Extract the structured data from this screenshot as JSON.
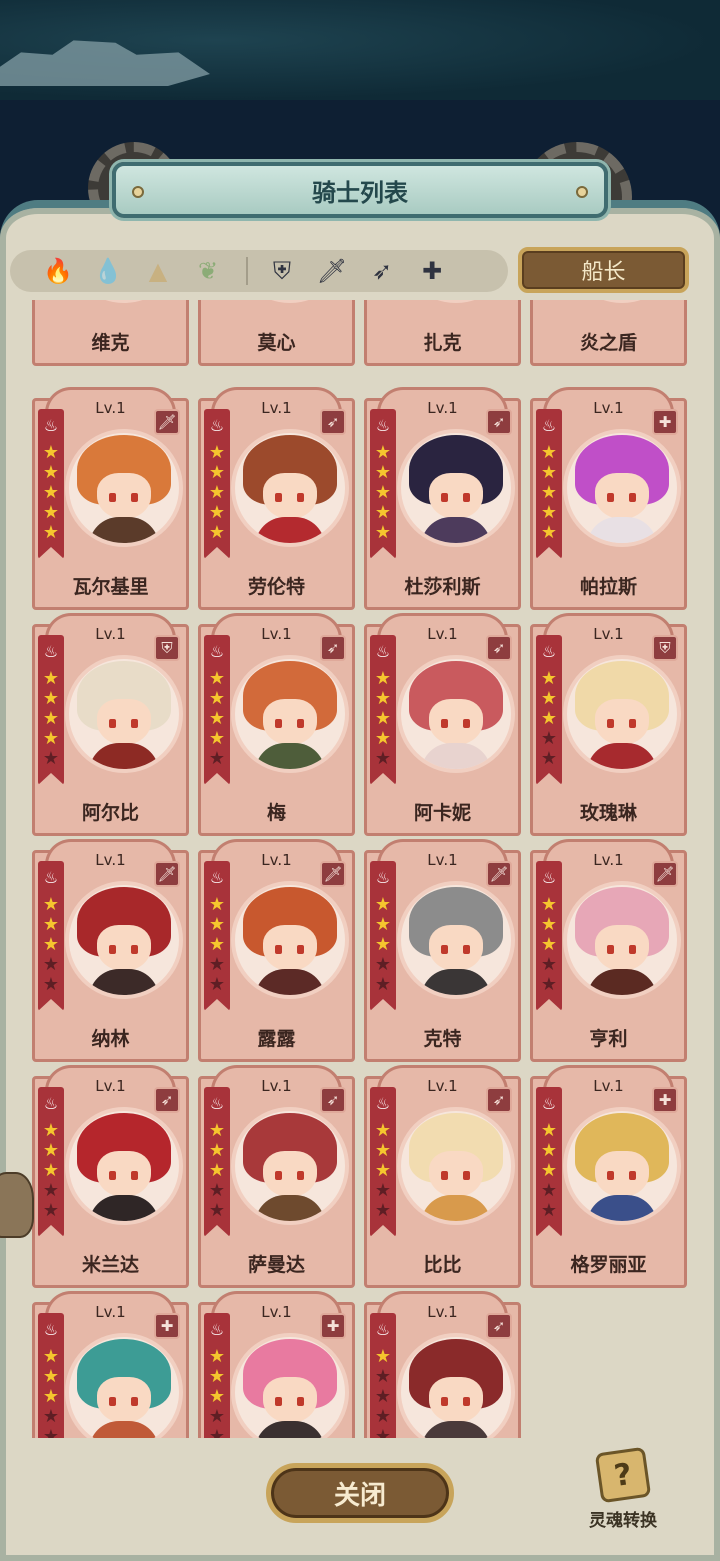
{
  "window": {
    "title": "骑士列表"
  },
  "filters": {
    "elements": [
      {
        "name": "fire-element-icon",
        "glyph": "🔥",
        "active": true,
        "color": "#d63a34"
      },
      {
        "name": "water-element-icon",
        "glyph": "💧",
        "active": false,
        "color": "#3f77c9"
      },
      {
        "name": "earth-element-icon",
        "glyph": "▲",
        "active": false,
        "color": "#c9a45e"
      },
      {
        "name": "wind-element-icon",
        "glyph": "❦",
        "active": false,
        "color": "#5d9b4c"
      }
    ],
    "classes": [
      {
        "name": "defender-class-icon",
        "glyph": "⛨"
      },
      {
        "name": "warrior-class-icon",
        "glyph": "🗡"
      },
      {
        "name": "ranger-class-icon",
        "glyph": "➶"
      },
      {
        "name": "support-class-icon",
        "glyph": "✚"
      }
    ]
  },
  "captain_button": {
    "label": "船长"
  },
  "partial_row": {
    "names": [
      "维克",
      "莫心",
      "扎克",
      "炎之盾"
    ]
  },
  "level_label": "Lv.1",
  "knights": [
    {
      "name": "瓦尔基里",
      "stars": 5,
      "class_icon": "sword-class-icon",
      "class_glyph": "🗡",
      "hair": "#d9793a",
      "outfit": "#5b3b2a"
    },
    {
      "name": "劳伦特",
      "stars": 5,
      "class_icon": "bow-class-icon",
      "class_glyph": "➶",
      "hair": "#9c4a2c",
      "outfit": "#b42a2f"
    },
    {
      "name": "杜莎利斯",
      "stars": 5,
      "class_icon": "bow-class-icon",
      "class_glyph": "➶",
      "hair": "#2a2440",
      "outfit": "#4d3b5c"
    },
    {
      "name": "帕拉斯",
      "stars": 5,
      "class_icon": "cross-class-icon",
      "class_glyph": "✚",
      "hair": "#c04fc8",
      "outfit": "#e8e0e4"
    },
    {
      "name": "阿尔比",
      "stars": 4,
      "class_icon": "shield-class-icon",
      "class_glyph": "⛨",
      "hair": "#e8dcc8",
      "outfit": "#8d2a24"
    },
    {
      "name": "梅",
      "stars": 4,
      "class_icon": "bow-class-icon",
      "class_glyph": "➶",
      "hair": "#d26a3a",
      "outfit": "#4e5d3a"
    },
    {
      "name": "阿卡妮",
      "stars": 4,
      "class_icon": "bow-class-icon",
      "class_glyph": "➶",
      "hair": "#c95a5e",
      "outfit": "#e8d3cf"
    },
    {
      "name": "玫瑰琳",
      "stars": 3,
      "class_icon": "shield-class-icon",
      "class_glyph": "⛨",
      "hair": "#f0d9a8",
      "outfit": "#a72a2e"
    },
    {
      "name": "纳林",
      "stars": 3,
      "class_icon": "sword-class-icon",
      "class_glyph": "🗡",
      "hair": "#a8282a",
      "outfit": "#3c2a28"
    },
    {
      "name": "露露",
      "stars": 3,
      "class_icon": "sword-class-icon",
      "class_glyph": "🗡",
      "hair": "#c8582e",
      "outfit": "#5c2a26"
    },
    {
      "name": "克特",
      "stars": 3,
      "class_icon": "sword-class-icon",
      "class_glyph": "🗡",
      "hair": "#8c8c8c",
      "outfit": "#3a3636"
    },
    {
      "name": "亨利",
      "stars": 3,
      "class_icon": "sword-class-icon",
      "class_glyph": "🗡",
      "hair": "#e7a7b7",
      "outfit": "#5b2a22"
    },
    {
      "name": "米兰达",
      "stars": 3,
      "class_icon": "bow-class-icon",
      "class_glyph": "➶",
      "hair": "#b5262c",
      "outfit": "#2f2626"
    },
    {
      "name": "萨曼达",
      "stars": 3,
      "class_icon": "bow-class-icon",
      "class_glyph": "➶",
      "hair": "#a8393a",
      "outfit": "#6e4a2e"
    },
    {
      "name": "比比",
      "stars": 3,
      "class_icon": "bow-class-icon",
      "class_glyph": "➶",
      "hair": "#f2dcb0",
      "outfit": "#d89a4c"
    },
    {
      "name": "格罗丽亚",
      "stars": 3,
      "class_icon": "cross-class-icon",
      "class_glyph": "✚",
      "hair": "#e0b75a",
      "outfit": "#3a4f8a"
    },
    {
      "name": "",
      "stars": 3,
      "class_icon": "cross-class-icon",
      "class_glyph": "✚",
      "hair": "#3d9c95",
      "outfit": "#c05a38"
    },
    {
      "name": "",
      "stars": 3,
      "class_icon": "cross-class-icon",
      "class_glyph": "✚",
      "hair": "#e87aa0",
      "outfit": "#3a3030"
    },
    {
      "name": "",
      "stars": 1,
      "class_icon": "bow-class-icon",
      "class_glyph": "➶",
      "hair": "#8a2a2a",
      "outfit": "#4a3a3a"
    }
  ],
  "close_button": {
    "label": "关闭"
  },
  "soul_convert": {
    "label": "灵魂转换",
    "glyph": "?"
  }
}
